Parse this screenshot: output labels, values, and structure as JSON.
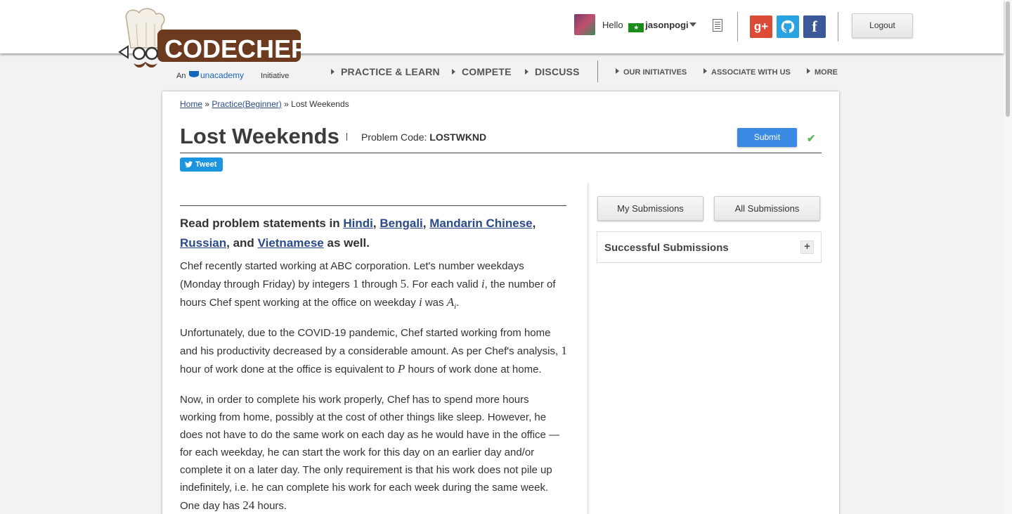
{
  "header": {
    "logo_text": "CODECHEF",
    "logo_tagline_prefix": "An",
    "logo_tagline_brand": "unacademy",
    "logo_tagline_suffix": "Initiative",
    "greeting": "Hello",
    "username": "jasonpogi",
    "logout_label": "Logout",
    "social": [
      "google-plus",
      "github",
      "facebook"
    ]
  },
  "nav": {
    "primary": [
      "PRACTICE & LEARN",
      "COMPETE",
      "DISCUSS"
    ],
    "secondary": [
      "OUR INITIATIVES",
      "ASSOCIATE WITH US",
      "MORE"
    ]
  },
  "breadcrumb": {
    "home": "Home",
    "sep1": "»",
    "practice": "Practice(Beginner)",
    "sep2": "»",
    "current": "Lost Weekends"
  },
  "problem": {
    "title": "Lost Weekends",
    "code_label": "Problem Code:",
    "code": "LOSTWKND",
    "submit_label": "Submit",
    "tweet_label": "Tweet"
  },
  "statement": {
    "lead_prefix": "Read problem statements in",
    "languages": [
      "Hindi",
      "Bengali",
      "Mandarin Chinese",
      "Russian",
      "Vietnamese"
    ],
    "lead_and": "and",
    "lead_suffix": "as well.",
    "p1": {
      "a": "Chef recently started working at ABC corporation. Let's number weekdays (Monday through Friday) by integers",
      "n1": "1",
      "b": "through",
      "n2": "5",
      "c": ". For each valid",
      "v1": "i",
      "d": ", the number of hours Chef spent working at the office on weekday",
      "v2": "i",
      "e": "was",
      "v3": "A",
      "v3sub": "i",
      "f": "."
    },
    "p2": {
      "a": "Unfortunately, due to the COVID-19 pandemic, Chef started working from home and his productivity decreased by a considerable amount. As per Chef's analysis,",
      "n1": "1",
      "b": "hour of work done at the office is equivalent to",
      "v1": "P",
      "c": "hours of work done at home."
    },
    "p3": {
      "a": "Now, in order to complete his work properly, Chef has to spend more hours working from home, possibly at the cost of other things like sleep. However, he does not have to do the same work on each day as he would have in the office — for each weekday, he can start the work for this day on an earlier day and/or complete it on a later day. The only requirement is that his work does not pile up indefinitely, i.e. he can complete his work for each week during the same week. One day has",
      "n1": "24",
      "b": "hours."
    }
  },
  "sidebar": {
    "my_submissions": "My Submissions",
    "all_submissions": "All Submissions",
    "successful_submissions": "Successful Submissions",
    "expand": "+"
  },
  "colors": {
    "accent_blue": "#3a8ae3",
    "link": "#2a4a8a",
    "brand_brown": "#6b3a1f",
    "tweet": "#1b95e0"
  }
}
